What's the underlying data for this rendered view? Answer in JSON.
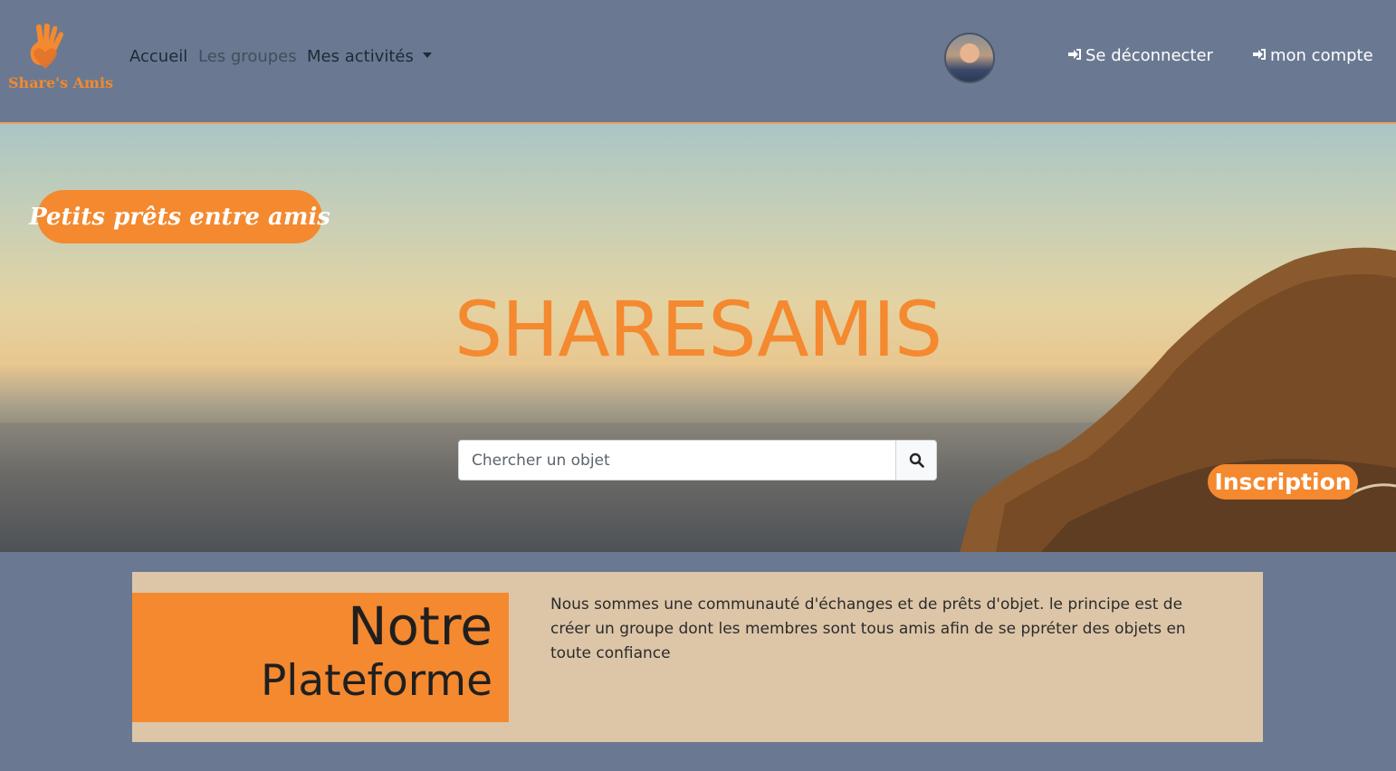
{
  "colors": {
    "accent": "#f4892f",
    "nav_bg": "#6a7991",
    "panel_bg": "#ddc6a8"
  },
  "brand": {
    "logo_text": "Share's Amis"
  },
  "nav": {
    "links": [
      "Accueil",
      "Les groupes",
      "Mes activités"
    ],
    "logout": "Se déconnecter",
    "account": "mon compte"
  },
  "hero": {
    "tagline": "Petits prêts entre amis",
    "title": "SHARESAMIS",
    "search_placeholder": "Chercher un objet",
    "inscription": "Inscription"
  },
  "platform": {
    "title_line1": "Notre",
    "title_line2": "Plateforme",
    "description": "Nous sommes une communauté d'échanges et de prêts d'objet. le principe est de créer un groupe dont les membres sont tous amis afin de se ppréter des objets en toute confiance"
  }
}
